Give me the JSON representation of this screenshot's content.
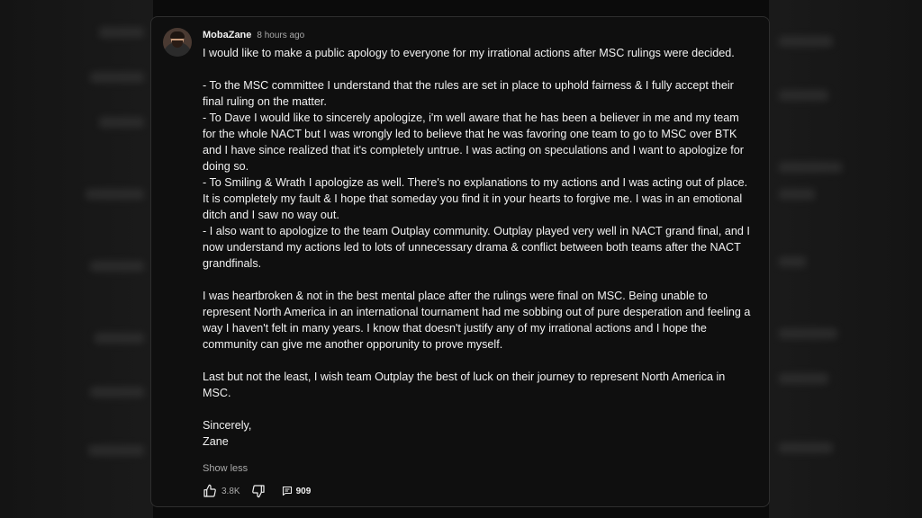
{
  "comment": {
    "author": "MobaZane",
    "timestamp": "8 hours ago",
    "paragraphs": [
      "I would like to make a public apology to everyone for my irrational actions after MSC rulings were decided.",
      "",
      "- To the MSC committee I understand that the rules are set in place to uphold fairness & I fully accept their final ruling on the matter.",
      "- To Dave I would like to sincerely apologize, i'm well aware that he has been a believer in me and my team for the whole NACT but I was wrongly led to believe that he was favoring one team to go to MSC over BTK and I have since realized that it's completely untrue. I was acting on speculations and I want to apologize for doing so.",
      "- To Smiling & Wrath I apologize as well. There's no explanations to my actions and I was acting out of place. It is completely my fault & I hope that someday you find it in your hearts to forgive me. I was in an emotional ditch and I saw no way out.",
      "- I also want to apologize to the team Outplay community. Outplay played very well in NACT grand final, and I now understand my actions led to lots of unnecessary drama & conflict between both teams after the NACT grandfinals.",
      "",
      "I was heartbroken & not in the best mental place after the rulings were final on MSC. Being unable to represent North America in an international tournament had me sobbing out of pure desperation and feeling a way I haven't felt in many years. I know that doesn't justify any of my irrational actions and I hope the community can give me another opporunity to prove myself.",
      "",
      "Last but not the least, I wish team Outplay the best of luck on their journey to represent North America in MSC.",
      "",
      "Sincerely,",
      "Zane"
    ],
    "show_less_label": "Show less",
    "like_count": "3.8K",
    "reply_count": "909"
  },
  "icons": {
    "like": "thumbs-up-icon",
    "dislike": "thumbs-down-icon",
    "reply": "comment-icon"
  },
  "colors": {
    "card_background": "#0f0f0f",
    "text": "#f1f1f1",
    "secondary_text": "#aaaaaa",
    "page_background": "#0b0b0b"
  }
}
